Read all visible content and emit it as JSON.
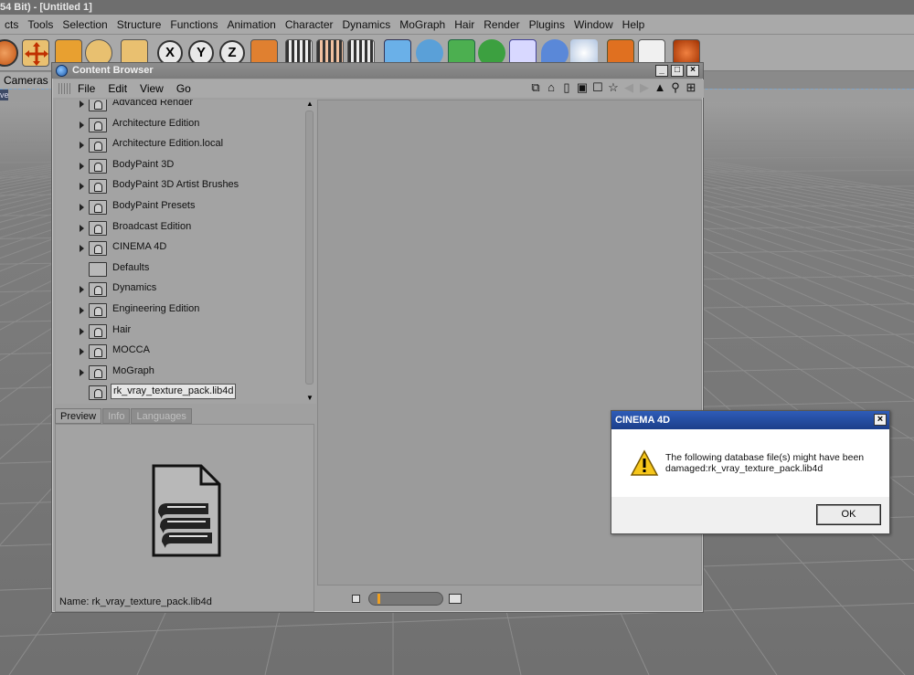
{
  "app": {
    "title": "54 Bit) - [Untitled 1]",
    "menu": [
      "cts",
      "Tools",
      "Selection",
      "Structure",
      "Functions",
      "Animation",
      "Character",
      "Dynamics",
      "MoGraph",
      "Hair",
      "Render",
      "Plugins",
      "Window",
      "Help"
    ],
    "view_menu": "Cameras",
    "view_tab": "ve"
  },
  "toolbar": {
    "axis_x": "X",
    "axis_y": "Y",
    "axis_z": "Z"
  },
  "content_browser": {
    "title": "Content Browser",
    "menu": [
      "File",
      "Edit",
      "View",
      "Go"
    ],
    "window_buttons": {
      "minimize": "_",
      "maximize": "□",
      "close": "×"
    },
    "tree": [
      {
        "label": "Advanced Render",
        "locked": true,
        "expandable": true
      },
      {
        "label": "Architecture Edition",
        "locked": true,
        "expandable": true
      },
      {
        "label": "Architecture Edition.local",
        "locked": true,
        "expandable": true
      },
      {
        "label": "BodyPaint 3D",
        "locked": true,
        "expandable": true
      },
      {
        "label": "BodyPaint 3D Artist Brushes",
        "locked": true,
        "expandable": true
      },
      {
        "label": "BodyPaint Presets",
        "locked": true,
        "expandable": true
      },
      {
        "label": "Broadcast Edition",
        "locked": true,
        "expandable": true
      },
      {
        "label": "CINEMA 4D",
        "locked": true,
        "expandable": true
      },
      {
        "label": "Defaults",
        "locked": false,
        "expandable": false
      },
      {
        "label": "Dynamics",
        "locked": true,
        "expandable": true
      },
      {
        "label": "Engineering Edition",
        "locked": true,
        "expandable": true
      },
      {
        "label": "Hair",
        "locked": true,
        "expandable": true
      },
      {
        "label": "MOCCA",
        "locked": true,
        "expandable": true
      },
      {
        "label": "MoGraph",
        "locked": true,
        "expandable": true
      },
      {
        "label": "rk_vray_texture_pack.lib4d",
        "locked": true,
        "expandable": false,
        "selected": true
      }
    ],
    "tabs": [
      {
        "label": "Preview",
        "active": true
      },
      {
        "label": "Info",
        "active": false
      },
      {
        "label": "Languages",
        "active": false
      }
    ],
    "preview_name": "Name: rk_vray_texture_pack.lib4d",
    "zoom_level": 0.12
  },
  "dialog": {
    "title": "CINEMA 4D",
    "close": "×",
    "message_line1": "The following database file(s) might have been",
    "message_line2": "damaged:rk_vray_texture_pack.lib4d",
    "ok_label": "OK"
  }
}
